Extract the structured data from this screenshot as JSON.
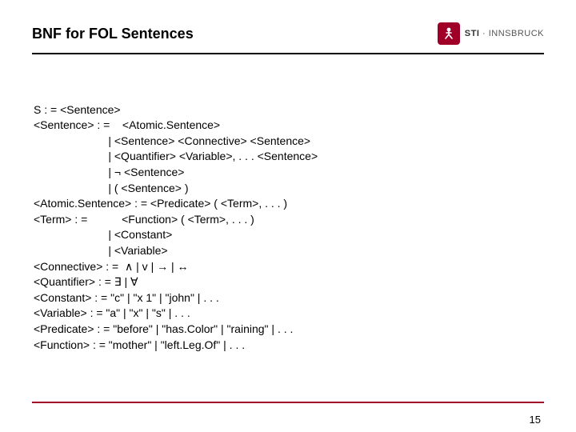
{
  "header": {
    "title": "BNF for FOL Sentences",
    "logo_brand": "STI",
    "logo_sep": " · ",
    "logo_place": "INNSBRUCK"
  },
  "bnf": {
    "l1": "S : = <Sentence>",
    "l2": "<Sentence> : =    <Atomic.Sentence>",
    "l3": "                        | <Sentence> <Connective> <Sentence>",
    "l4": "                        | <Quantifier> <Variable>, . . . <Sentence>",
    "l5": "                        | ¬ <Sentence>",
    "l6": "                        | ( <Sentence> )",
    "l7": "<Atomic.Sentence> : = <Predicate> ( <Term>, . . . )",
    "l8": "<Term> : =           <Function> ( <Term>, . . . )",
    "l9": "                        | <Constant>",
    "l10": "                        | <Variable>",
    "l11": "<Connective> : =  ∧ | v | → | ↔",
    "l12": "<Quantifier> : = ∃ | ∀",
    "l13": "<Constant> : = \"c\" | \"x 1\" | \"john\" | . . .",
    "l14": "<Variable> : = \"a\" | \"x\" | \"s\" | . . .",
    "l15": "<Predicate> : = \"before\" | \"has.Color\" | \"raining\" | . . .",
    "l16": "<Function> : = \"mother\" | \"left.Leg.Of\" | . . ."
  },
  "page_number": "15"
}
